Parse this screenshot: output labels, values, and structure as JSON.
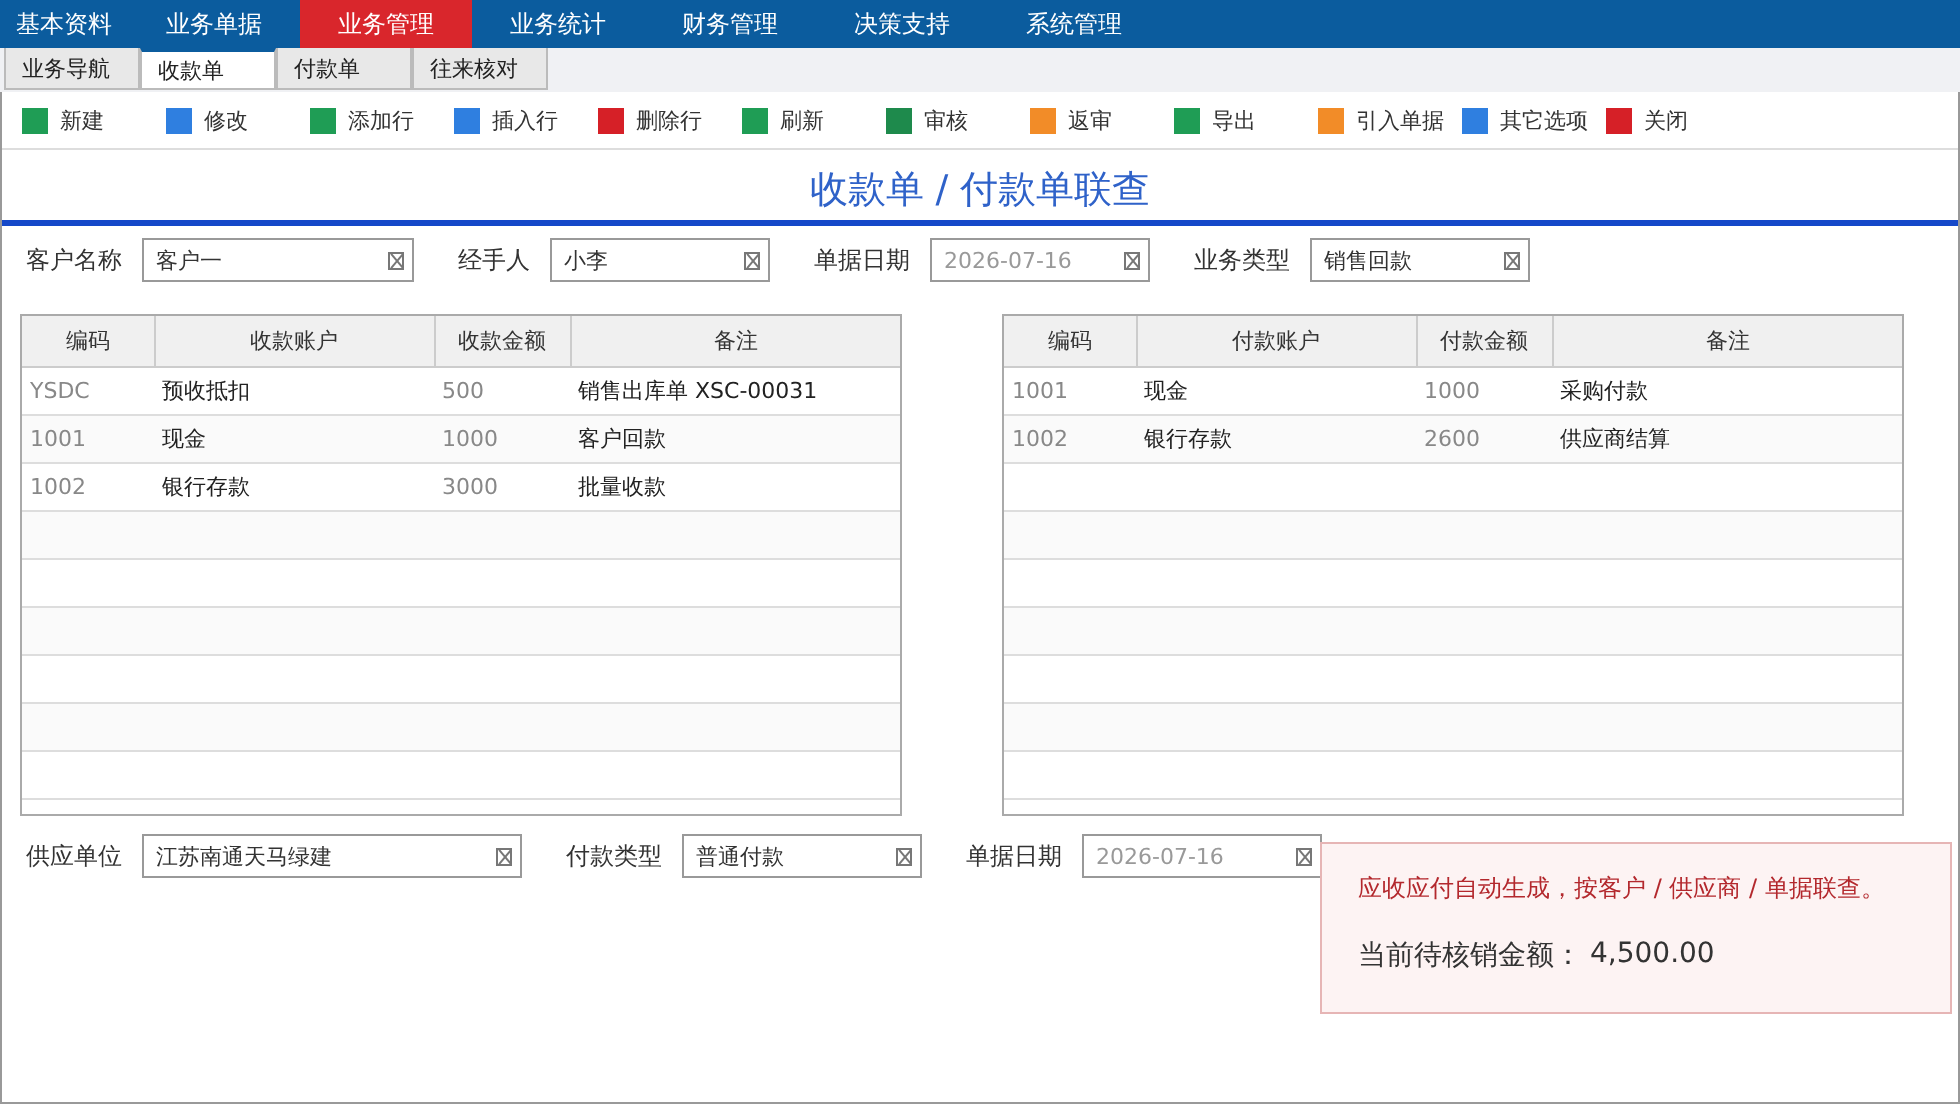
{
  "menu": [
    {
      "label": "基本资料",
      "selected": false
    },
    {
      "label": "业务单据",
      "selected": false
    },
    {
      "label": "业务管理",
      "selected": true
    },
    {
      "label": "业务统计",
      "selected": false
    },
    {
      "label": "财务管理",
      "selected": false
    },
    {
      "label": "决策支持",
      "selected": false
    },
    {
      "label": "系统管理",
      "selected": false
    }
  ],
  "tabs": [
    {
      "label": "业务导航",
      "selected": false
    },
    {
      "label": "收款单",
      "selected": true
    },
    {
      "label": "付款单",
      "selected": false
    },
    {
      "label": "往来核对",
      "selected": false
    }
  ],
  "toolbar": [
    {
      "label": "新建",
      "color": "#1f9d55"
    },
    {
      "label": "修改",
      "color": "#2f7fe0"
    },
    {
      "label": "添加行",
      "color": "#1f9d55"
    },
    {
      "label": "插入行",
      "color": "#2f7fe0"
    },
    {
      "label": "删除行",
      "color": "#d62027"
    },
    {
      "label": "刷新",
      "color": "#1f9d55"
    },
    {
      "label": "审核",
      "color": "#1e8a4c"
    },
    {
      "label": "返审",
      "color": "#f28c28"
    },
    {
      "label": "导出",
      "color": "#1f9d55"
    },
    {
      "label": "引入单据",
      "color": "#f28c28"
    },
    {
      "label": "其它选项",
      "color": "#2f7fe0"
    },
    {
      "label": "关闭",
      "color": "#d62027"
    }
  ],
  "title": "收款单 / 付款单联查",
  "top_fields": [
    {
      "label": "客户名称",
      "value": "客户一",
      "kind": "text"
    },
    {
      "label": "经手人",
      "value": "小李",
      "kind": "text"
    },
    {
      "label": "单据日期",
      "value": "2026-07-16",
      "kind": "date"
    },
    {
      "label": "业务类型",
      "value": "销售回款",
      "kind": "text"
    }
  ],
  "receipt_table": {
    "columns": [
      "编码",
      "收款账户",
      "收款金额",
      "备注"
    ],
    "rows": [
      [
        "YSDC",
        "预收抵扣",
        "500",
        "销售出库单 XSC-00031"
      ],
      [
        "1001",
        "现金",
        "1000",
        "客户回款"
      ],
      [
        "1002",
        "银行存款",
        "3000",
        "批量收款"
      ]
    ]
  },
  "payment_table": {
    "columns": [
      "编码",
      "付款账户",
      "付款金额",
      "备注"
    ],
    "rows": [
      [
        "1001",
        "现金",
        "1000",
        "采购付款"
      ],
      [
        "1002",
        "银行存款",
        "2600",
        "供应商结算"
      ]
    ]
  },
  "bottom_fields": [
    {
      "label": "供应单位",
      "value": "江苏南通天马绿建",
      "kind": "text"
    },
    {
      "label": "付款类型",
      "value": "普通付款",
      "kind": "text"
    },
    {
      "label": "单据日期",
      "value": "2026-07-16",
      "kind": "date"
    }
  ],
  "notice": {
    "message": "应收应付自动生成，按客户 / 供应商 / 单据联查。",
    "total_label": "当前待核销金额：",
    "total": "4,500.00"
  }
}
